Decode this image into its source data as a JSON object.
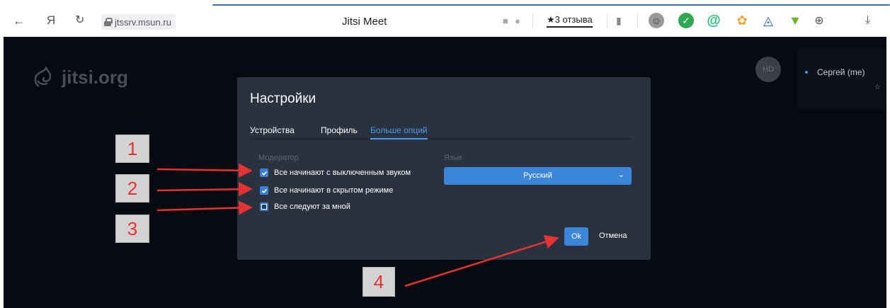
{
  "browser": {
    "back_glyph": "←",
    "yandex_glyph": "Я",
    "reload_glyph": "↻",
    "url": "jtssrv.msun.ru",
    "tab_title": "Jitsi Meet",
    "reviews_label": "3 отзыва",
    "download_glyph": "⤓",
    "icons": [
      "back-icon",
      "yandex-icon",
      "reload-icon",
      "lock-icon",
      "camera-icon",
      "mic-icon",
      "star-icon",
      "bookmark-icon",
      "extension-spy-icon",
      "shield-icon",
      "at-icon",
      "paw-icon",
      "prism-icon",
      "download-arrow-icon",
      "puzzle-icon",
      "download-icon"
    ]
  },
  "stage": {
    "watermark": "jitsi.org",
    "avatar_initials": "HD",
    "participant_name": "Сергей (me)"
  },
  "modal": {
    "title": "Настройки",
    "tabs": [
      {
        "label": "Устройства",
        "active": false
      },
      {
        "label": "Профиль",
        "active": false
      },
      {
        "label": "Больше опций",
        "active": true
      }
    ],
    "moderator_label": "Модератор",
    "options": [
      {
        "label": "Все начинают с выключенным звуком",
        "checked": true
      },
      {
        "label": "Все начинают в скрытом режиме",
        "checked": true
      },
      {
        "label": "Все следуют за мной",
        "checked": false
      }
    ],
    "language_label": "Язык",
    "language_value": "Русский",
    "ok_label": "Ok",
    "cancel_label": "Отмена"
  },
  "annotations": [
    "1",
    "2",
    "3",
    "4"
  ],
  "colors": {
    "stage_bg": "#070a10",
    "modal_bg": "#2a3240",
    "accent": "#3b86d9",
    "annotation_red": "#e53232"
  }
}
